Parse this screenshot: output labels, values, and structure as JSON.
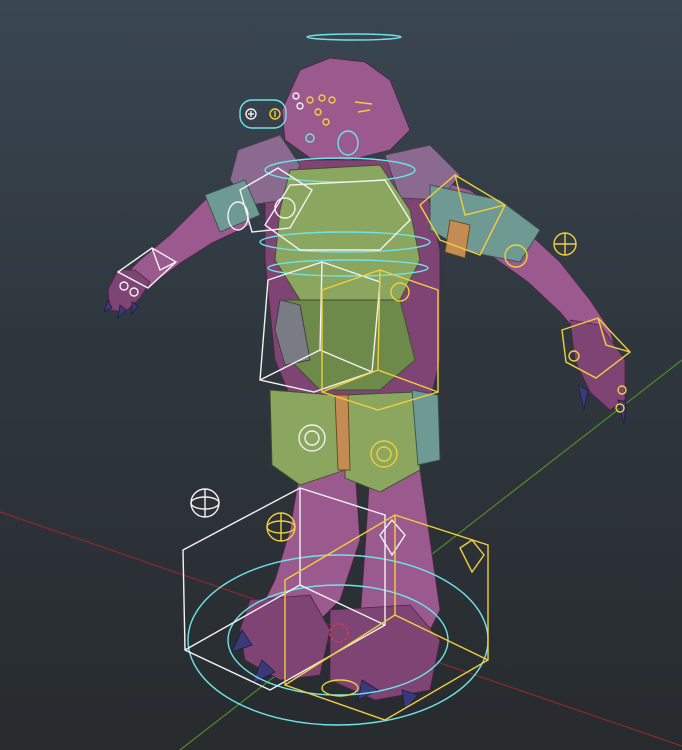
{
  "viewport": {
    "background_top": "#3a4651",
    "background_bottom": "#272b2e"
  },
  "grid": {
    "x_axis_color": "#8a2a2a",
    "z_axis_color": "#4f8a2a"
  },
  "rig": {
    "skin_color": "#9b5a8d",
    "armor_color": "#8aa65f",
    "control_colors": {
      "white": "#f2f2f2",
      "yellow": "#f1cf3c",
      "cyan": "#6fe3e8"
    }
  }
}
